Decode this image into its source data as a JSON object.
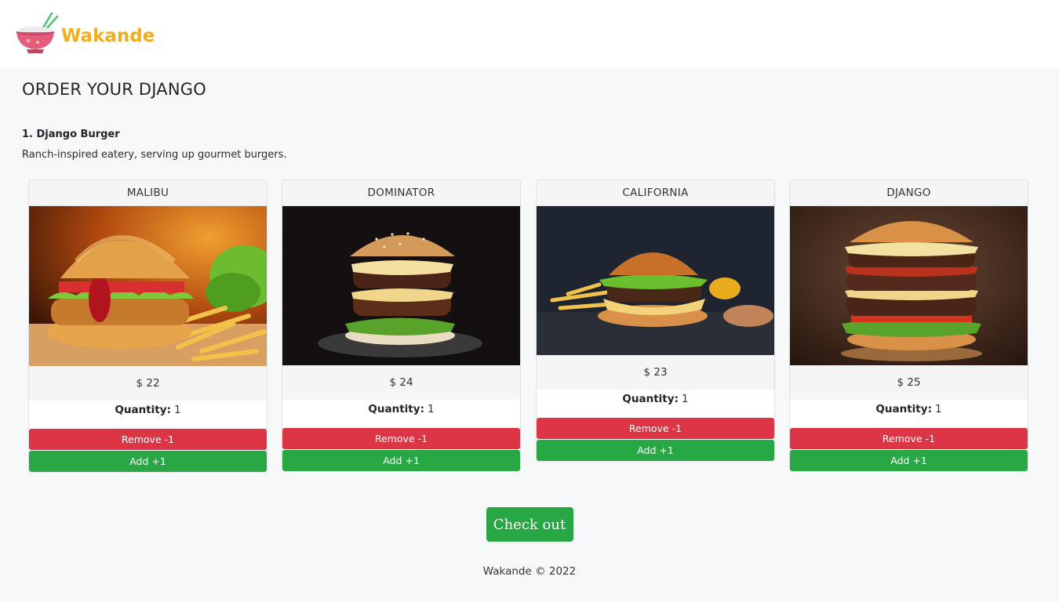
{
  "brand": {
    "name": "Wakande"
  },
  "page": {
    "title": "ORDER YOUR DJANGO"
  },
  "restaurant": {
    "name": "1. Django Burger",
    "description": "Ranch-inspired eatery, serving up gourmet burgers."
  },
  "quantity_label": "Quantity:",
  "items": [
    {
      "name": "MALIBU",
      "price": "$ 22",
      "quantity": "1",
      "remove_label": "Remove -1",
      "add_label": "Add +1",
      "image": "burger-with-fries-photo"
    },
    {
      "name": "DOMINATOR",
      "price": "$ 24",
      "quantity": "1",
      "remove_label": "Remove -1",
      "add_label": "Add +1",
      "image": "double-burger-photo"
    },
    {
      "name": "CALIFORNIA",
      "price": "$ 23",
      "quantity": "1",
      "remove_label": "Remove -1",
      "add_label": "Add +1",
      "image": "burger-with-fries-dark-photo"
    },
    {
      "name": "DJANGO",
      "price": "$ 25",
      "quantity": "1",
      "remove_label": "Remove -1",
      "add_label": "Add +1",
      "image": "tall-stacked-burger-photo"
    }
  ],
  "checkout": {
    "label": "Check out"
  },
  "footer": {
    "text": "Wakande © 2022"
  },
  "colors": {
    "brand": "#f2ad1d",
    "remove": "#dc3545",
    "add": "#28a745",
    "background": "#f7f8fa"
  }
}
